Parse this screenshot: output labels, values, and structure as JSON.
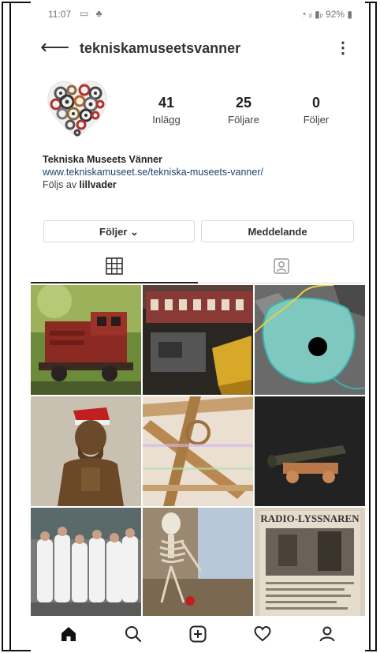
{
  "status_bar": {
    "time": "11:07",
    "right": "92%"
  },
  "header": {
    "back_icon": "arrow-left-icon",
    "username": "tekniskamuseetsvanner",
    "more_icon": "more-vertical-icon"
  },
  "profile": {
    "avatar_icon": "gear-heart-avatar",
    "stats": [
      {
        "value": "41",
        "label": "Inlägg"
      },
      {
        "value": "25",
        "label": "Följare"
      },
      {
        "value": "0",
        "label": "Följer"
      }
    ],
    "name": "Tekniska Museets Vänner",
    "website": "www.tekniskamuseet.se/tekniska-museets-vanner/",
    "followed_by_prefix": "Följs av ",
    "followed_by_user": "lillvader"
  },
  "actions": {
    "following_label": "Följer ⌄",
    "message_label": "Meddelande"
  },
  "tabs": [
    {
      "icon": "grid-icon",
      "active": true
    },
    {
      "icon": "tagged-person-icon",
      "active": false
    }
  ],
  "grid": [
    {
      "subject": "red model locomotive"
    },
    {
      "subject": "model train car with yellow wagon"
    },
    {
      "subject": "turquoise aerial map"
    },
    {
      "subject": "bronze statue with santa hat"
    },
    {
      "subject": "wooden mechanism close-up"
    },
    {
      "subject": "miniature cannon"
    },
    {
      "subject": "group in white protective suits"
    },
    {
      "subject": "skeleton model"
    },
    {
      "subject": "Radio-Lyssnaren magazine"
    }
  ],
  "magazine_title": "RADIO-LYSSNAREN",
  "bottom_nav": [
    {
      "icon": "home-icon"
    },
    {
      "icon": "search-icon"
    },
    {
      "icon": "add-post-icon"
    },
    {
      "icon": "heart-icon"
    },
    {
      "icon": "profile-icon"
    }
  ],
  "colors": {
    "link": "#1f3f6f",
    "border": "#dbdbdb",
    "text": "#262626"
  }
}
